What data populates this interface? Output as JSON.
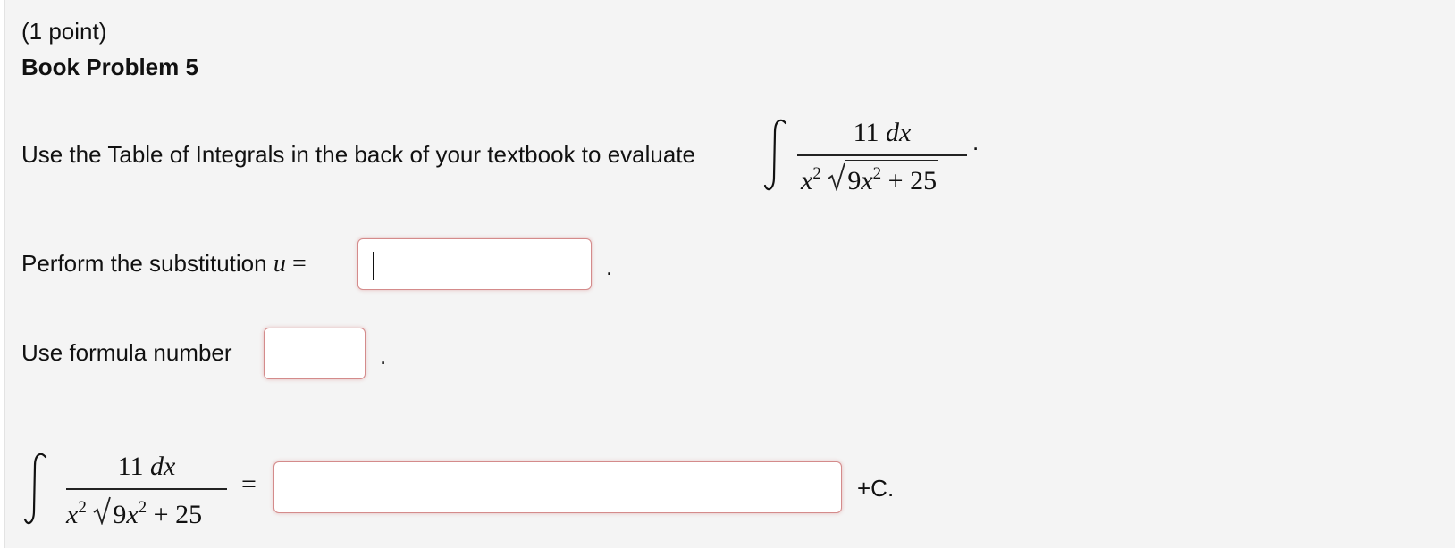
{
  "header": {
    "points": "(1 point)",
    "title": "Book Problem 5"
  },
  "problem": {
    "instruction": "Use the Table of Integrals in the back of your textbook to evaluate",
    "integrand_num_coef": "11",
    "integrand_num_diff": "dx",
    "den_var": "x",
    "den_exp": "2",
    "rad_coef": "9",
    "rad_var": "x",
    "rad_exp": "2",
    "rad_tail": "+ 25",
    "end_period": "."
  },
  "substitution": {
    "label": "Perform the substitution",
    "var": "u",
    "equals": "=",
    "value": "",
    "end_period": "."
  },
  "formula": {
    "label": "Use formula number",
    "value": "",
    "end_period": "."
  },
  "result": {
    "equals": "=",
    "value": "",
    "suffix": "+C."
  },
  "colors": {
    "panel_bg": "#f4f4f4",
    "input_border": "#d48b8b"
  }
}
